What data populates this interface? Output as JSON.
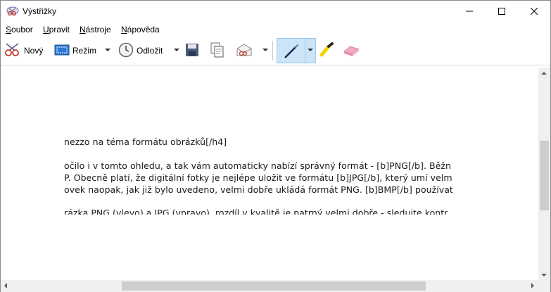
{
  "window": {
    "title": "Výstřižky"
  },
  "menu": [
    {
      "label": "Soubor",
      "u": "S",
      "rest": "oubor"
    },
    {
      "label": "Upravit",
      "u": "U",
      "rest": "pravit"
    },
    {
      "label": "Nástroje",
      "u": "N",
      "rest": "ástroje"
    },
    {
      "label": "Nápověda",
      "u": "N",
      "rest": "ápověda"
    }
  ],
  "toolbar": {
    "new_label": "Nový",
    "mode_label": "Režim",
    "delay_label": "Odložit"
  },
  "content": {
    "lines": [
      "nezzo na téma formátu obrázků[/h4]",
      "očilo i v tomto ohledu, a tak vám automaticky nabízí správný formát - [b]PNG[/b]. Běžn",
      "P. Obecně platí, že digitální fotky je nejlépe uložit ve formátu [b]JPG[/b], který umí velm",
      "ovek naopak, jak již bylo uvedeno, velmi dobře ukládá formát PNG. [b]BMP[/b] používat",
      "rázka PNG (vlevo) a JPG (vpravo), rozdíl v kvalitě je patrný velmi dobře - sledujte kontr"
    ]
  },
  "colors": {
    "accent": "#cce4f7",
    "accent_border": "#99c9ef",
    "spell": "#e03030"
  }
}
